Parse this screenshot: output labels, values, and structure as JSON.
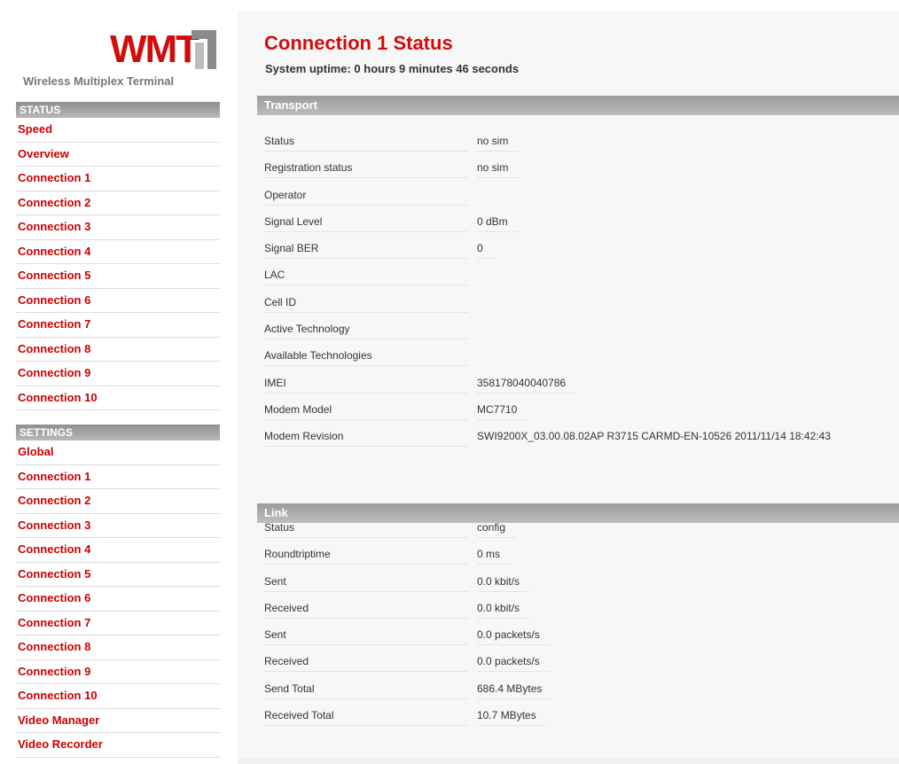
{
  "logo": {
    "wordmark": "WMT",
    "subtitle": "Wireless Multiplex Terminal",
    "brand_color": "#d40b0b"
  },
  "sidebar": {
    "status_header": "STATUS",
    "status_items": [
      {
        "label": "Speed"
      },
      {
        "label": "Overview"
      },
      {
        "label": "Connection 1"
      },
      {
        "label": "Connection 2"
      },
      {
        "label": "Connection 3"
      },
      {
        "label": "Connection 4"
      },
      {
        "label": "Connection 5"
      },
      {
        "label": "Connection 6"
      },
      {
        "label": "Connection 7"
      },
      {
        "label": "Connection 8"
      },
      {
        "label": "Connection 9"
      },
      {
        "label": "Connection 10"
      }
    ],
    "settings_header": "SETTINGS",
    "settings_items": [
      {
        "label": "Global"
      },
      {
        "label": "Connection 1"
      },
      {
        "label": "Connection 2"
      },
      {
        "label": "Connection 3"
      },
      {
        "label": "Connection 4"
      },
      {
        "label": "Connection 5"
      },
      {
        "label": "Connection 6"
      },
      {
        "label": "Connection 7"
      },
      {
        "label": "Connection 8"
      },
      {
        "label": "Connection 9"
      },
      {
        "label": "Connection 10"
      },
      {
        "label": "Video Manager"
      },
      {
        "label": "Video Recorder"
      }
    ]
  },
  "main": {
    "title": "Connection 1 Status",
    "uptime": "System uptime: 0 hours 9 minutes 46 seconds",
    "transport": {
      "header": "Transport",
      "rows": [
        {
          "label": "Status",
          "value": "no sim"
        },
        {
          "label": "Registration status",
          "value": "no sim"
        },
        {
          "label": "Operator",
          "value": ""
        },
        {
          "label": "Signal Level",
          "value": "0 dBm"
        },
        {
          "label": "Signal BER",
          "value": "0"
        },
        {
          "label": "LAC",
          "value": ""
        },
        {
          "label": "Cell ID",
          "value": ""
        },
        {
          "label": "Active Technology",
          "value": ""
        },
        {
          "label": "Available Technologies",
          "value": ""
        },
        {
          "label": "IMEI",
          "value": "358178040040786"
        },
        {
          "label": "Modem Model",
          "value": "MC7710"
        },
        {
          "label": "Modem Revision",
          "value": "SWI9200X_03.00.08.02AP R3715 CARMD-EN-10526 2011/11/14 18:42:43"
        }
      ]
    },
    "link": {
      "header": "Link",
      "rows": [
        {
          "label": "Status",
          "value": "config"
        },
        {
          "label": "Roundtriptime",
          "value": "0 ms"
        },
        {
          "label": "Sent",
          "value": "0.0 kbit/s"
        },
        {
          "label": "Received",
          "value": "0.0 kbit/s"
        },
        {
          "label": "Sent",
          "value": "0.0 packets/s"
        },
        {
          "label": "Received",
          "value": "0.0 packets/s"
        },
        {
          "label": "Send Total",
          "value": "686.4 MBytes"
        },
        {
          "label": "Received Total",
          "value": "10.7 MBytes"
        }
      ]
    }
  }
}
